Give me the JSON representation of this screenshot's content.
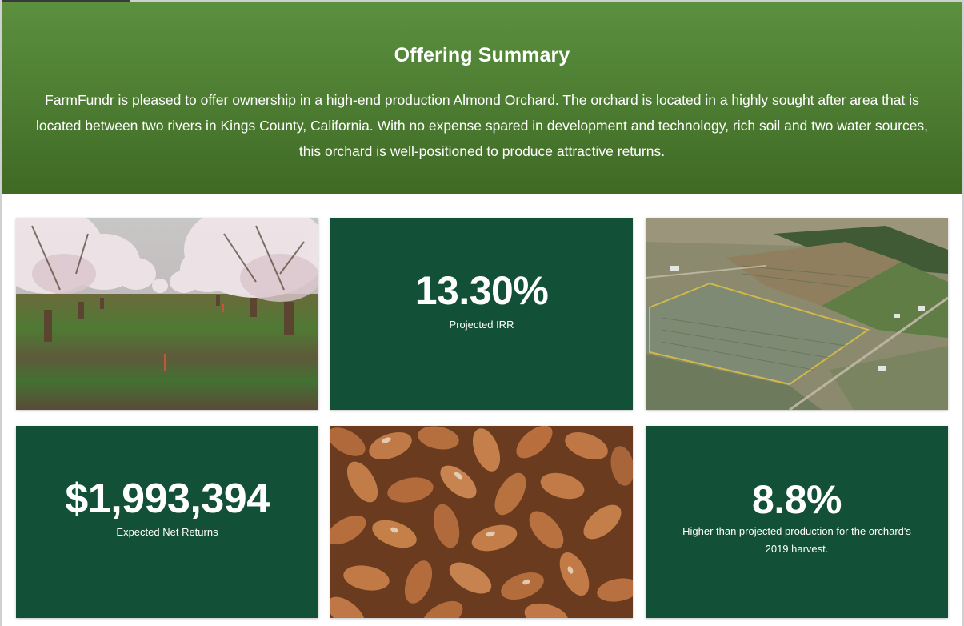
{
  "summary": {
    "title": "Offering Summary",
    "description": "FarmFundr is pleased to offer ownership in a high-end production Almond Orchard. The orchard is located in a highly sought after area that is located between two rivers in Kings County, California. With no expense spared in development and technology, rich soil and two water sources, this orchard is well-positioned to produce attractive returns."
  },
  "stats": {
    "irr": {
      "value": "13.30%",
      "label": "Projected IRR"
    },
    "net_returns": {
      "value": "$1,993,394",
      "label": "Expected Net Returns"
    },
    "production": {
      "value": "8.8%",
      "label": "Higher than projected production for the orchard's 2019 harvest."
    }
  },
  "colors": {
    "hero_green": "#4f7f34",
    "stat_green": "#135038"
  }
}
